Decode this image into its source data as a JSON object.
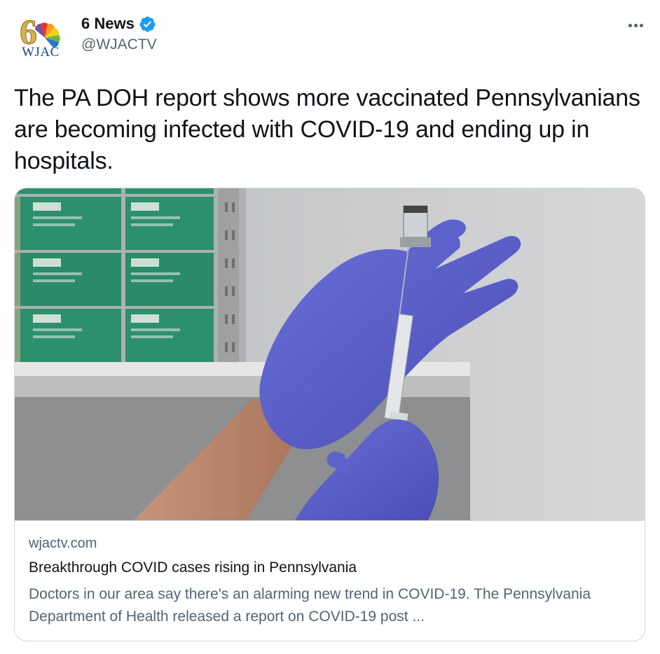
{
  "author": {
    "display_name": "6 News",
    "handle": "@WJACTV",
    "verified": true,
    "avatar_label": "WJAC",
    "avatar_icon": "wjac-nbc-peacock-logo"
  },
  "menu": {
    "icon": "more-horizontal-icon"
  },
  "tweet": {
    "text": "The PA DOH report shows more vaccinated Pennsylvanians are becoming infected with COVID-19 and ending up in hospitals."
  },
  "card": {
    "image_description_icon": "vaccine-syringe-gloved-hands-photo",
    "domain": "wjactv.com",
    "title": "Breakthrough COVID cases rising in Pennsylvania",
    "description": "Doctors in our area say there's an alarming new trend in COVID-19. The Pennsylvania Department of Health released a report on COVID-19 post ..."
  },
  "colors": {
    "verified_blue": "#1d9bf0",
    "secondary_text": "#536471",
    "primary_text": "#0f1419",
    "border": "#cfd9de",
    "glove_purple": "#5b5fc7",
    "box_green": "#2e8f6e"
  }
}
